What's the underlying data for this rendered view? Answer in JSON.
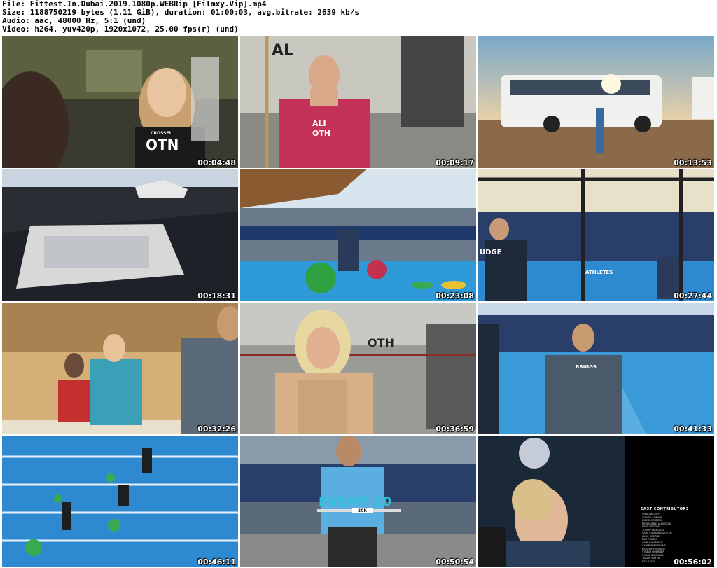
{
  "header": {
    "file_line": "File: Fittest.In.Dubai.2019.1080p.WEBRip [Filmxy.Vip].mp4",
    "size_line": "Size: 1188750219 bytes (1.11 GiB), duration: 01:00:03, avg.bitrate: 2639 kb/s",
    "audio_line": "Audio: aac, 48000 Hz, 5:1 (und)",
    "video_line": "Video: h264, yuv420p, 1920x1072, 25.00 fps(r) (und)"
  },
  "thumbnails": [
    {
      "timestamp": "00:04:48",
      "shirt_text": "OTN",
      "shirt_top": "CROSSFI"
    },
    {
      "timestamp": "00:09:17",
      "shirt_text": "ALI\nOTH",
      "bg_text": "AL"
    },
    {
      "timestamp": "00:13:53"
    },
    {
      "timestamp": "00:18:31"
    },
    {
      "timestamp": "00:23:08"
    },
    {
      "timestamp": "00:27:44",
      "shirt_text": "UDGE",
      "banner_text": "ATHLETES"
    },
    {
      "timestamp": "00:32:26"
    },
    {
      "timestamp": "00:36:59",
      "bg_text": "OTH"
    },
    {
      "timestamp": "00:41:33",
      "shirt_text": "BRIGGS"
    },
    {
      "timestamp": "00:46:11"
    },
    {
      "timestamp": "00:50:54",
      "overlay_title": "EVENT 10",
      "overlay_sub": "30K"
    },
    {
      "timestamp": "00:56:02",
      "credits_title": "CAST CONTRIBUTORS",
      "credits_names": [
        "CRAIG RICHEY",
        "ADRIEN ADRIAN",
        "DIEGO CENTENO",
        "MOHAMMED ALHUSSINI",
        "DAVE WATSON",
        "TOMMY MARQUEZ",
        "SARA SIGMUNDSDOTTIR",
        "JAMIE GREENE",
        "MAT FRASER",
        "LAURA HORVATH",
        "CARMEN BOSMANS",
        "KRISTOF HORVATH",
        "STREAT HOERNER",
        "CHASE INGRAHAM",
        "TRAVIS MAYER",
        "BEN SMITH"
      ]
    }
  ]
}
